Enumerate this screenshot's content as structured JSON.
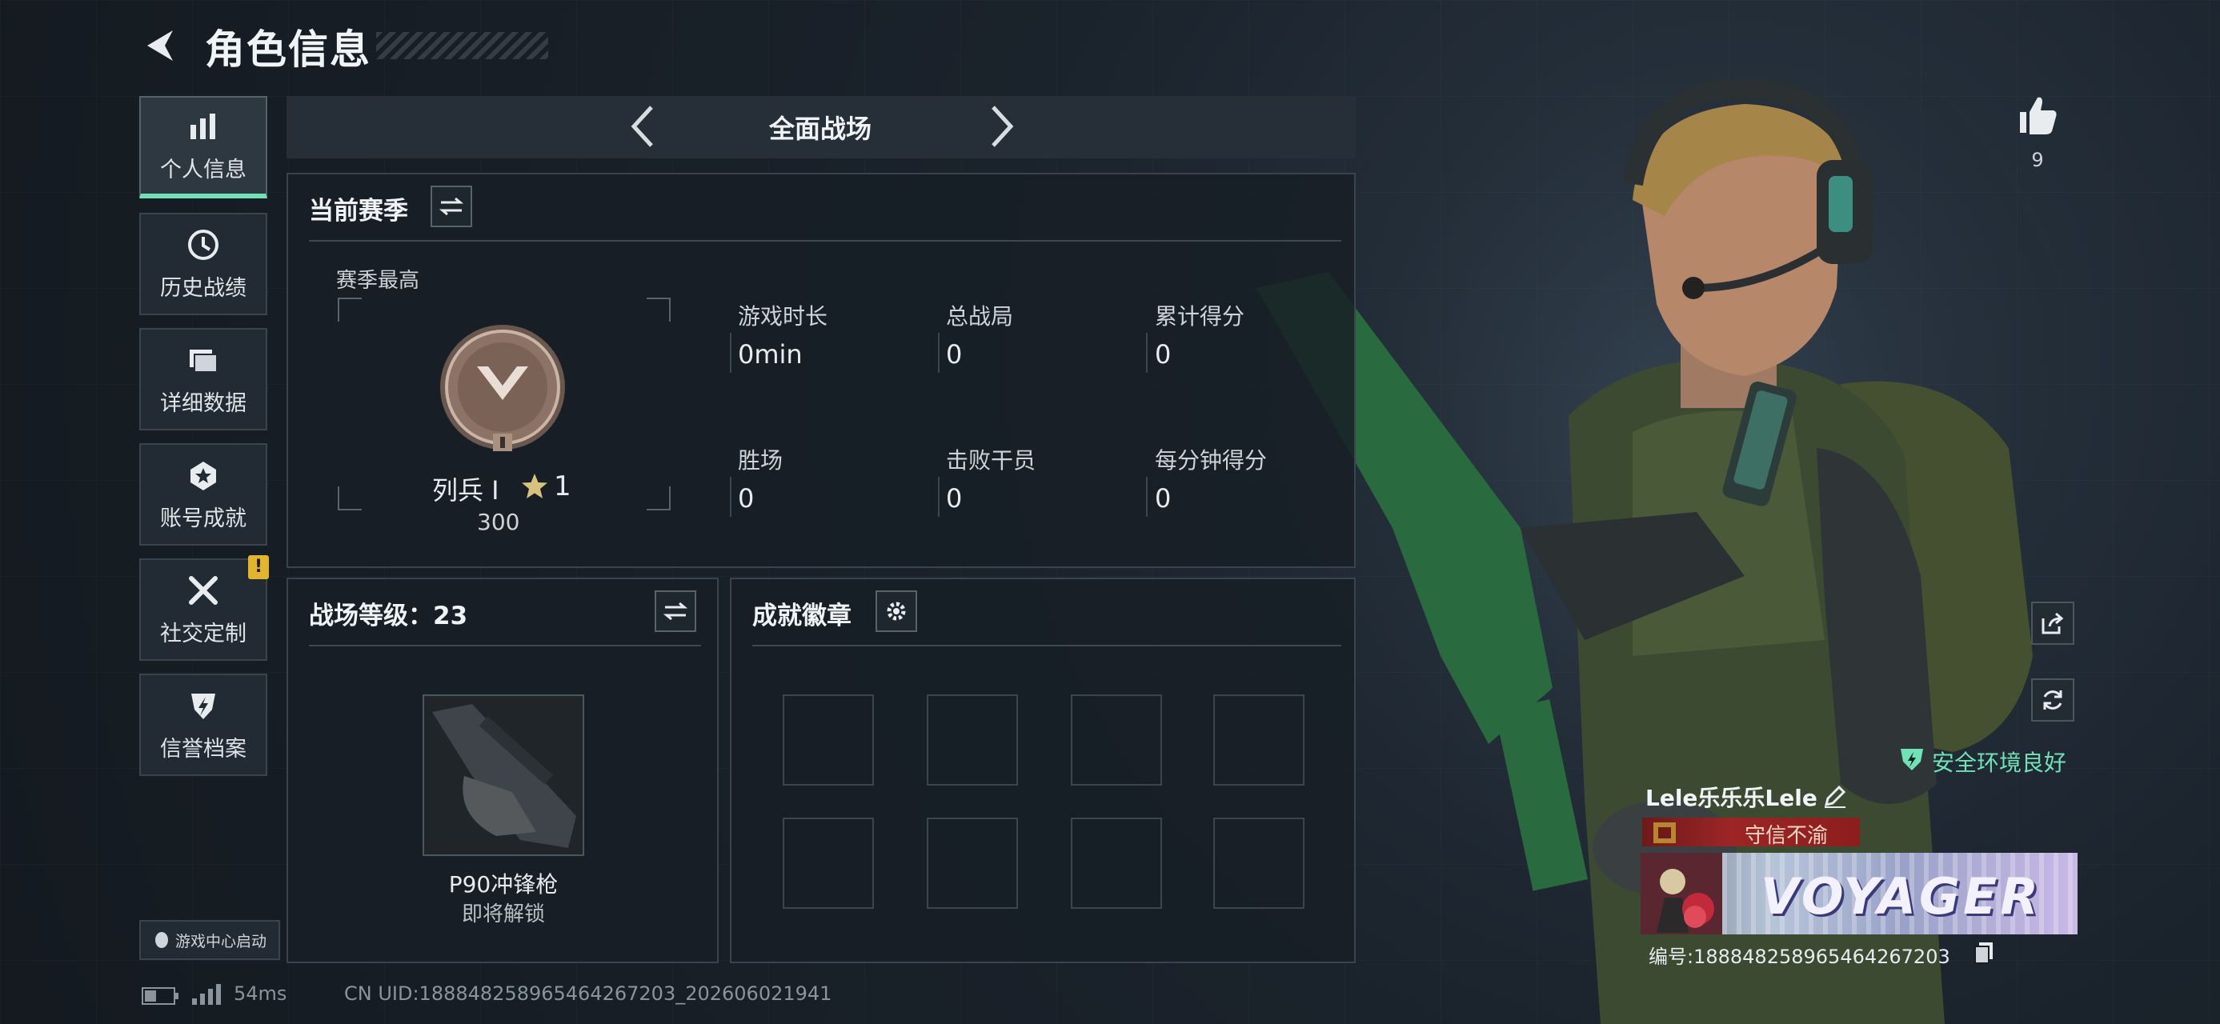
{
  "header": {
    "title": "角色信息"
  },
  "sidebar": {
    "items": [
      {
        "label": "个人信息",
        "icon": "bar-chart-icon"
      },
      {
        "label": "历史战绩",
        "icon": "history-clock-icon"
      },
      {
        "label": "详细数据",
        "icon": "folder-icon"
      },
      {
        "label": "账号成就",
        "icon": "medal-icon"
      },
      {
        "label": "社交定制",
        "icon": "wrench-tools-icon"
      },
      {
        "label": "信誉档案",
        "icon": "shield-icon"
      }
    ],
    "warning_badge": "!",
    "game_center": "游戏中心启动"
  },
  "mode": {
    "label": "全面战场"
  },
  "season": {
    "title": "当前赛季",
    "best_label": "赛季最高",
    "rank_name": "列兵 I",
    "rank_stars": "1",
    "rank_points": "300",
    "stats": [
      {
        "label": "游戏时长",
        "value": "0min"
      },
      {
        "label": "总战局",
        "value": "0"
      },
      {
        "label": "累计得分",
        "value": "0"
      },
      {
        "label": "胜场",
        "value": "0"
      },
      {
        "label": "击败干员",
        "value": "0"
      },
      {
        "label": "每分钟得分",
        "value": "0"
      }
    ]
  },
  "battlefield_level": {
    "title": "战场等级：23",
    "weapon_name": "P90冲锋枪",
    "weapon_status": "即将解锁"
  },
  "achievement_badges": {
    "title": "成就徽章",
    "slots": 8
  },
  "likes": {
    "count": "9"
  },
  "security": {
    "text": "安全环境良好"
  },
  "player": {
    "name": "Lele乐乐乐Lele",
    "honor_title": "守信不渝",
    "card_text": "VOYAGER",
    "id_text": "编号:18884825896546426720​3"
  },
  "status_bar": {
    "ping": "54ms",
    "uid": "CN UID:18884825896546426720​3_20260602194​1"
  },
  "colors": {
    "accent_green": "#6fe3b5",
    "honor_red": "#8d1e1e",
    "warning_yellow": "#e3b52a"
  }
}
